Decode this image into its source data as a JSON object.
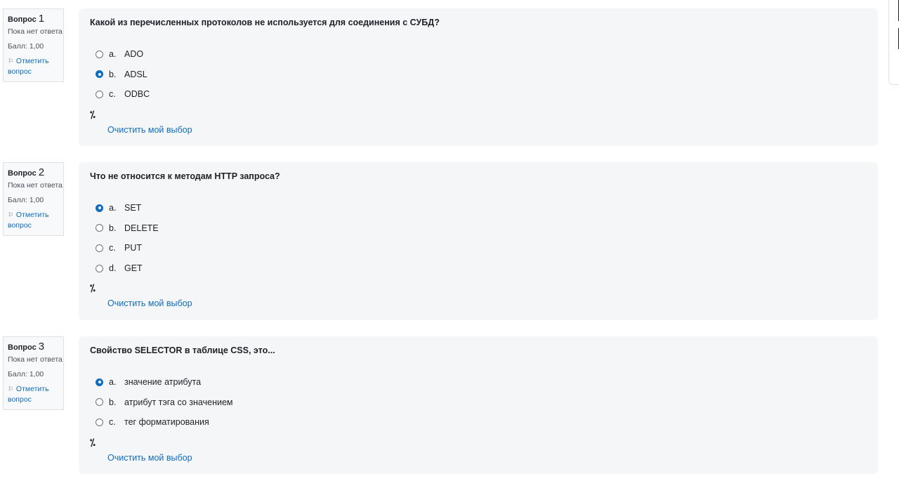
{
  "questions": [
    {
      "label": "Вопрос",
      "number": "1",
      "state": "Пока нет ответа",
      "grade": "Балл: 1,00",
      "flag": "Отметить вопрос",
      "text": "Какой из перечисленных протоколов не используется для соединения с СУБД?",
      "options": [
        {
          "letter": "a.",
          "text": "ADO",
          "checked": false
        },
        {
          "letter": "b.",
          "text": "ADSL",
          "checked": true
        },
        {
          "letter": "c.",
          "text": "ODBC",
          "checked": false
        }
      ],
      "clear": "Очистить мой выбор"
    },
    {
      "label": "Вопрос",
      "number": "2",
      "state": "Пока нет ответа",
      "grade": "Балл: 1,00",
      "flag": "Отметить вопрос",
      "text": "Что не относится к методам HTTP запроса?",
      "options": [
        {
          "letter": "a.",
          "text": "SET",
          "checked": true
        },
        {
          "letter": "b.",
          "text": "DELETE",
          "checked": false
        },
        {
          "letter": "c.",
          "text": "PUT",
          "checked": false
        },
        {
          "letter": "d.",
          "text": "GET",
          "checked": false
        }
      ],
      "clear": "Очистить мой выбор"
    },
    {
      "label": "Вопрос",
      "number": "3",
      "state": "Пока нет ответа",
      "grade": "Балл: 1,00",
      "flag": "Отметить вопрос",
      "text": "Свойство SELECTOR в таблице CSS, это...",
      "options": [
        {
          "letter": "a.",
          "text": "значение атрибута",
          "checked": true
        },
        {
          "letter": "b.",
          "text": "атрибут тэга со значением",
          "checked": false
        },
        {
          "letter": "c.",
          "text": "тег форматирования",
          "checked": false
        }
      ],
      "clear": "Очистить мой выбор"
    }
  ],
  "icons": {
    "flag": "flag-icon",
    "tool": "magic-wand-icon"
  },
  "colors": {
    "accent": "#0f6cbf",
    "panel": "#f5f6f8",
    "info_bg": "#f8f9fa",
    "border": "#dee2e6"
  }
}
